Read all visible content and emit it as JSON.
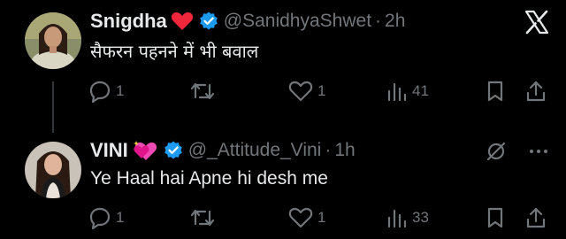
{
  "tweets": [
    {
      "name": "Snigdha",
      "emoji_icon": "red-heart-icon",
      "handle": "@SanidhyaShwet",
      "separator": "·",
      "time": "2h",
      "text": "सैफरन पहनने में भी बवाल",
      "actions": {
        "reply": "1",
        "retweet": "",
        "like": "1",
        "views": "41"
      }
    },
    {
      "name": "VINI",
      "emoji_icon": "sparkling-heart-icon",
      "handle": "@_Attitude_Vini",
      "separator": "·",
      "time": "1h",
      "text": "Ye Haal hai Apne hi desh me",
      "actions": {
        "reply": "1",
        "retweet": "",
        "like": "1",
        "views": "33"
      }
    }
  ],
  "colors": {
    "background": "#000000",
    "text": "#e7e9ea",
    "muted": "#71767b",
    "verified": "#1d9bf0",
    "heart": "#f91880"
  }
}
